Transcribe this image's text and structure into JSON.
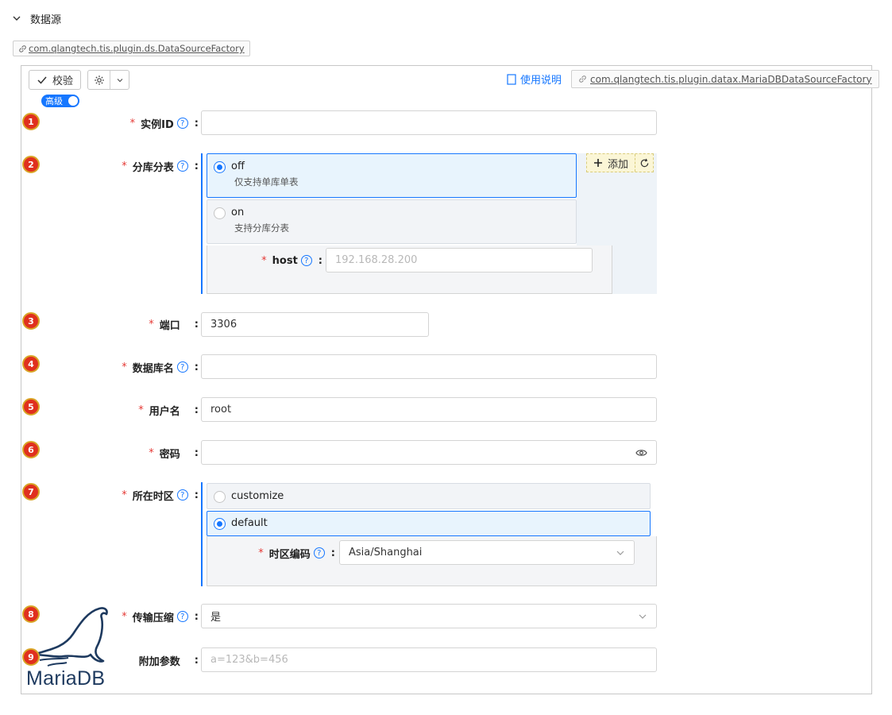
{
  "section": {
    "title": "数据源"
  },
  "plugin_class": "com.qlangtech.tis.plugin.ds.DataSourceFactory",
  "toolbar": {
    "verify_label": "校验",
    "advanced_label": "高级",
    "help_label": "使用说明",
    "impl_class": "com.qlangtech.tis.plugin.datax.MariaDBDataSourceFactory"
  },
  "colors": {
    "accent": "#1677ff",
    "required": "#e53935",
    "badge_fill": "#e0301e",
    "badge_ring": "#d9a526"
  },
  "fields": {
    "instance_id": {
      "badge": "1",
      "label": "实例ID",
      "value": ""
    },
    "sharding": {
      "badge": "2",
      "label": "分库分表",
      "options": [
        {
          "title": "off",
          "desc": "仅支持单库单表",
          "selected": true
        },
        {
          "title": "on",
          "desc": "支持分库分表",
          "selected": false
        }
      ],
      "add_label": "添加",
      "host": {
        "label": "host",
        "placeholder": "192.168.28.200"
      }
    },
    "port": {
      "badge": "3",
      "label": "端口",
      "value": "3306"
    },
    "db_name": {
      "badge": "4",
      "label": "数据库名",
      "value": ""
    },
    "username": {
      "badge": "5",
      "label": "用户名",
      "value": "root"
    },
    "password": {
      "badge": "6",
      "label": "密码",
      "value": ""
    },
    "timezone": {
      "badge": "7",
      "label": "所在时区",
      "options": [
        {
          "title": "customize",
          "selected": false
        },
        {
          "title": "default",
          "selected": true
        }
      ],
      "tz_code": {
        "label": "时区编码",
        "value": "Asia/Shanghai"
      }
    },
    "compress": {
      "badge": "8",
      "label": "传输压缩",
      "value": "是"
    },
    "extra_params": {
      "badge": "9",
      "label": "附加参数",
      "placeholder": "a=123&b=456"
    }
  },
  "logo": {
    "text": "MariaDB"
  }
}
